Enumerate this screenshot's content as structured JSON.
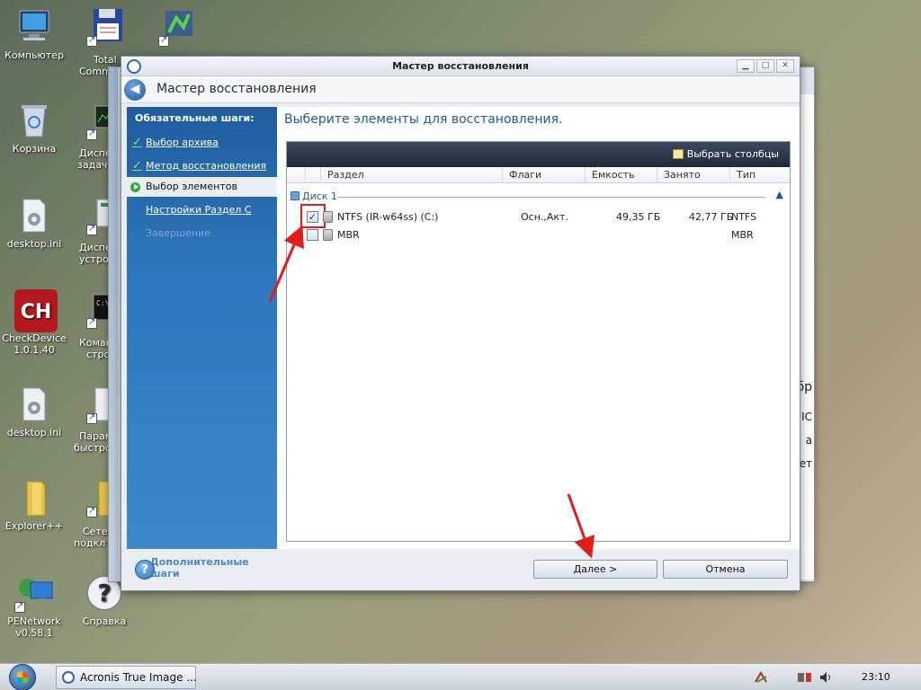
{
  "desktop": {
    "icons": [
      {
        "label": "Компьютер"
      },
      {
        "label": "Total Comm"
      },
      {
        "label": "Корзина"
      },
      {
        "label": "Диспе задач"
      },
      {
        "label": "desktop.ini"
      },
      {
        "label": "Диспе устро"
      },
      {
        "label": "CheckDevice 1.0.1.40"
      },
      {
        "label": "Коман стро"
      },
      {
        "label": "desktop.ini"
      },
      {
        "label": "Парам быстро"
      },
      {
        "label": "Explorer++"
      },
      {
        "label": "Сетев подкл"
      },
      {
        "label": "PENetwork v0.58.1"
      },
      {
        "label": "Справка"
      }
    ]
  },
  "background_window": {
    "partial_texts": [
      "бр",
      "ІС",
      "а",
      "ет"
    ]
  },
  "dialog": {
    "title": "Мастер восстановления",
    "header_title": "Мастер восстановления",
    "window_buttons": {
      "minimize": "▁",
      "maximize": "□",
      "close": "✕"
    },
    "sidebar": {
      "heading": "Обязательные шаги:",
      "steps": [
        {
          "label": "Выбор архива",
          "state": "done"
        },
        {
          "label": "Метод восстановления",
          "state": "done"
        },
        {
          "label": "Выбор элементов",
          "state": "current"
        },
        {
          "label": "Настройки Раздел C",
          "state": "link"
        },
        {
          "label": "Завершение",
          "state": "disabled"
        }
      ],
      "optional_heading": "Дополнительные шаги"
    },
    "content_title": "Выберите элементы для восстановления.",
    "choose_columns": "Выбрать столбцы",
    "columns": [
      "Раздел",
      "Флаги",
      "Емкость",
      "Занято",
      "Тип"
    ],
    "group": "Диск 1",
    "rows": [
      {
        "checked": "✓",
        "name": "NTFS (IR-w64ss) (C:)",
        "flags": "Осн.,Акт.",
        "capacity": "49,35 ГБ",
        "used": "42,77 ГБ",
        "type": "NTFS"
      },
      {
        "checked": "",
        "name": "MBR",
        "flags": "",
        "capacity": "",
        "used": "",
        "type": "MBR"
      }
    ],
    "buttons": {
      "next": "Далее >",
      "cancel": "Отмена",
      "help": "?"
    }
  },
  "taskbar": {
    "task": "Acronis True Image ...",
    "clock": "23:10"
  },
  "colors": {
    "annotation": "#e21b1b",
    "sidebar": "#2e78bd",
    "accent_text": "#1e5a96"
  }
}
